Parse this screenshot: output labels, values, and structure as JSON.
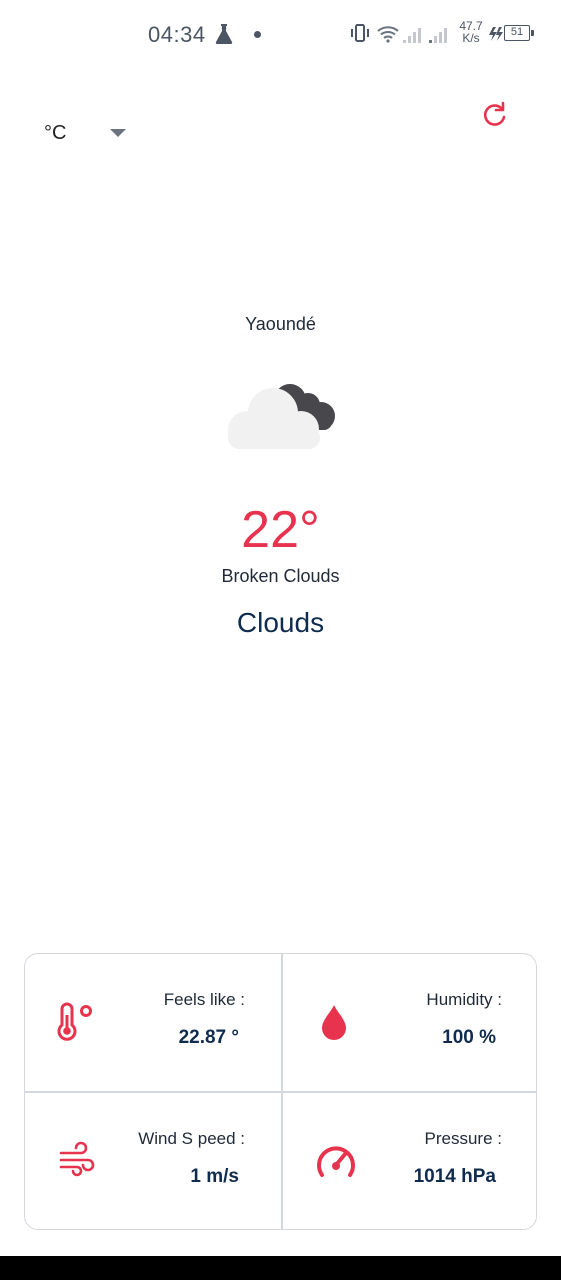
{
  "status_bar": {
    "time": "04:34",
    "net_speed_value": "47.7",
    "net_speed_unit": "K/s",
    "battery": "51"
  },
  "controls": {
    "unit": "°C",
    "refresh_icon": "refresh-icon"
  },
  "weather": {
    "city": "Yaoundé",
    "icon": "broken-clouds-icon",
    "temperature": "22°",
    "description": "Broken Clouds",
    "main": "Clouds"
  },
  "stats": {
    "feels_like": {
      "label": "Feels like :",
      "value": "22.87 °",
      "icon": "thermometer-icon"
    },
    "humidity": {
      "label": "Humidity :",
      "value": "100 %",
      "icon": "water-drop-icon"
    },
    "wind_speed": {
      "label": "Wind S peed :",
      "value": "1 m/s",
      "icon": "wind-icon"
    },
    "pressure": {
      "label": "Pressure :",
      "value": "1014 hPa",
      "icon": "gauge-icon"
    }
  },
  "colors": {
    "accent": "#e8334e",
    "value_text": "#0f2c4f",
    "divider": "#d4d7dd"
  }
}
